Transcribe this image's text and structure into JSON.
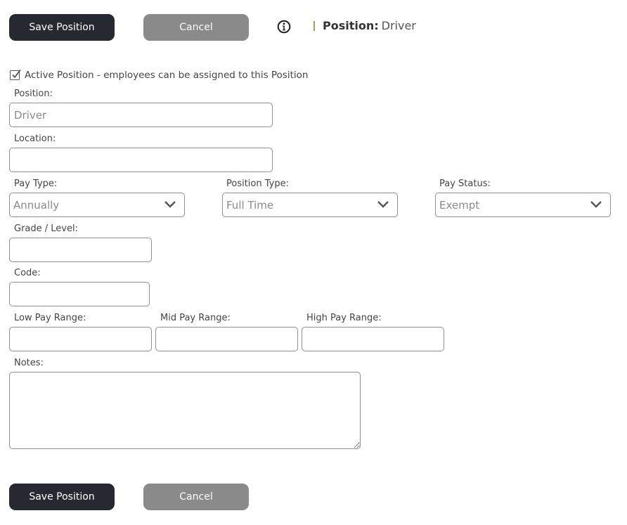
{
  "toolbar_top": {
    "save_label": "Save Position",
    "cancel_label": "Cancel"
  },
  "header": {
    "position_label": "Position:",
    "position_value": "Driver"
  },
  "active_checkbox": {
    "checked": true,
    "label": "Active Position - employees can be assigned to this Position"
  },
  "form": {
    "position": {
      "label": "Position:",
      "placeholder": "Driver",
      "value": ""
    },
    "location": {
      "label": "Location:",
      "value": ""
    },
    "pay_type": {
      "label": "Pay Type:",
      "selected": "Annually"
    },
    "position_type": {
      "label": "Position Type:",
      "selected": "Full Time"
    },
    "pay_status": {
      "label": "Pay Status:",
      "selected": "Exempt"
    },
    "grade_level": {
      "label": "Grade / Level:",
      "value": ""
    },
    "code": {
      "label": "Code:",
      "value": ""
    },
    "low_pay_range": {
      "label": "Low Pay Range:",
      "value": ""
    },
    "mid_pay_range": {
      "label": "Mid Pay Range:",
      "value": ""
    },
    "high_pay_range": {
      "label": "High Pay Range:",
      "value": ""
    },
    "notes": {
      "label": "Notes:",
      "value": ""
    }
  },
  "toolbar_bottom": {
    "save_label": "Save Position",
    "cancel_label": "Cancel"
  },
  "icons": {
    "info": "info-circle-icon",
    "checkbox": "checkmark-icon",
    "dropdown": "chevron-down-icon"
  },
  "colors": {
    "primary_button": "#262a30",
    "secondary_button": "#8a8a8a",
    "header_separator": "#9aa35a",
    "field_border": "#8e8e8e"
  }
}
